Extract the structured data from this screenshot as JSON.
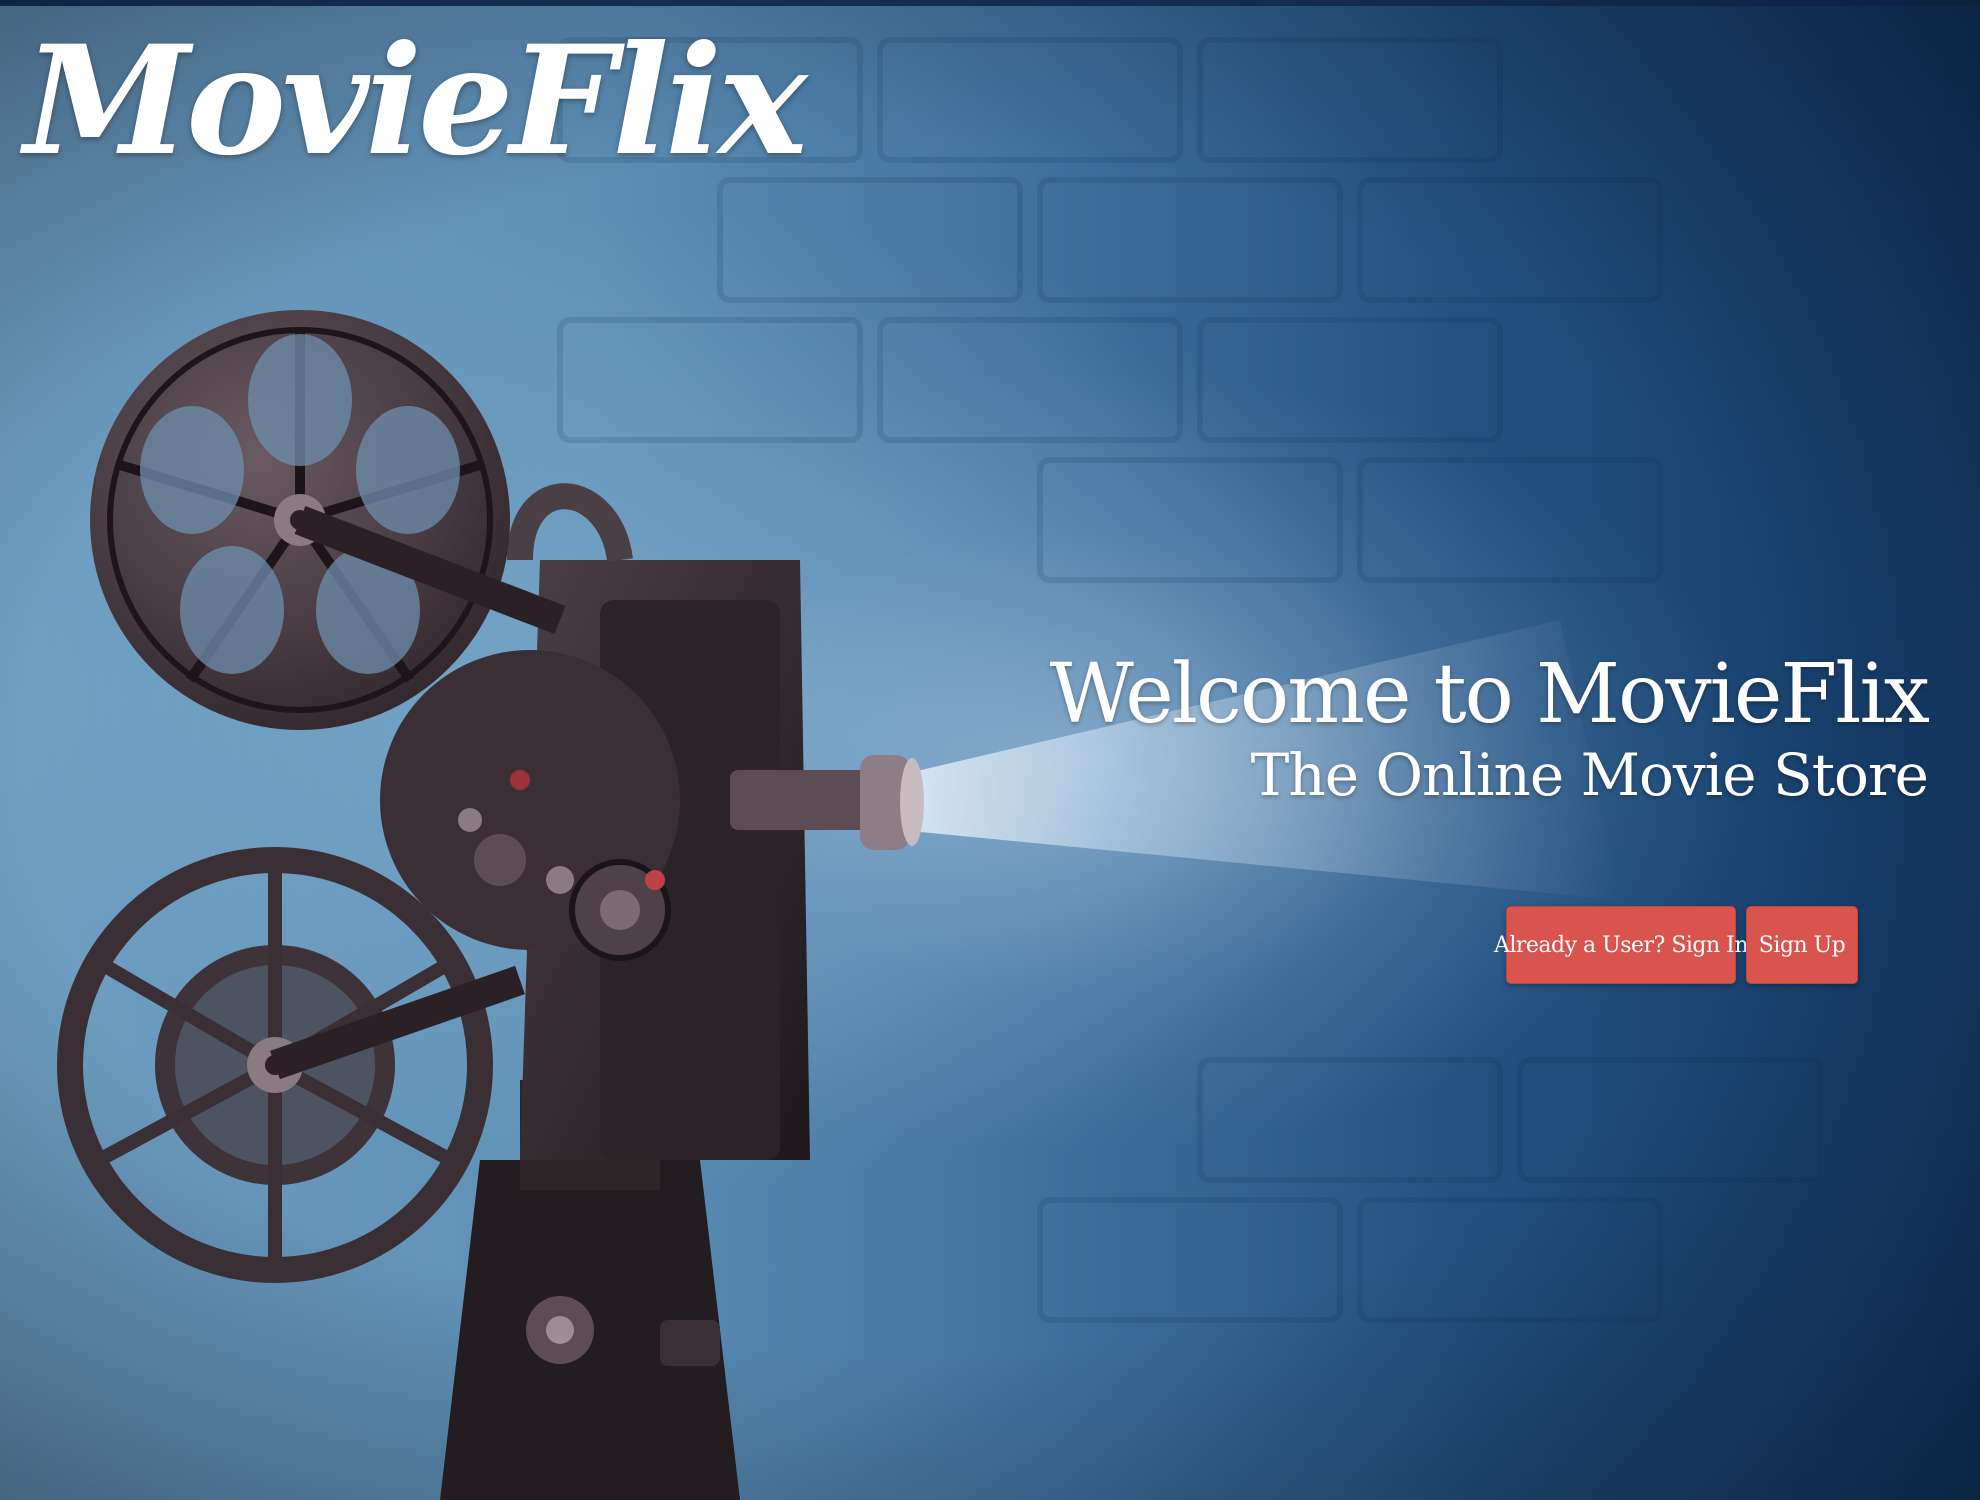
{
  "brand": {
    "logo_text": "MovieFlix"
  },
  "hero": {
    "title": "Welcome to MovieFlix",
    "subtitle": "The Online Movie Store"
  },
  "actions": {
    "signin_label": "Already a User? Sign In",
    "signup_label": "Sign Up"
  },
  "colors": {
    "button": "#d9534f",
    "background_dark": "#143a66",
    "background_light": "#6f9fc1",
    "text": "#ffffff"
  },
  "illustration": {
    "subject": "vintage-film-projector-icon"
  }
}
